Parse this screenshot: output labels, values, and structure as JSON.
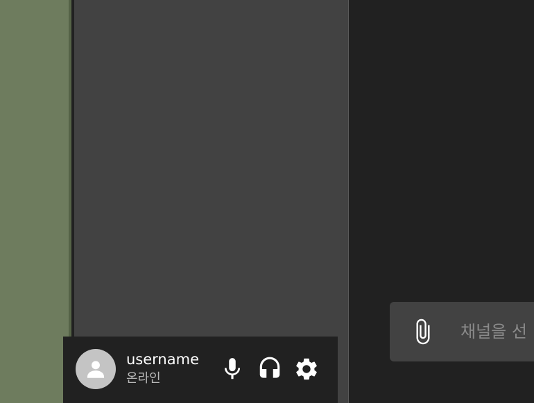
{
  "user_panel": {
    "username": "username",
    "status": "온라인",
    "icons": {
      "avatar": "default-user-avatar",
      "mic": "microphone-icon",
      "headset": "headphones-icon",
      "settings": "gear-icon"
    }
  },
  "composer": {
    "placeholder": "채널을 선",
    "attach_icon": "paperclip-icon"
  },
  "colors": {
    "server_rail": "#6e7c5e",
    "channel_panel": "#424242",
    "chat_background": "#212121",
    "composer_background": "#424242"
  }
}
